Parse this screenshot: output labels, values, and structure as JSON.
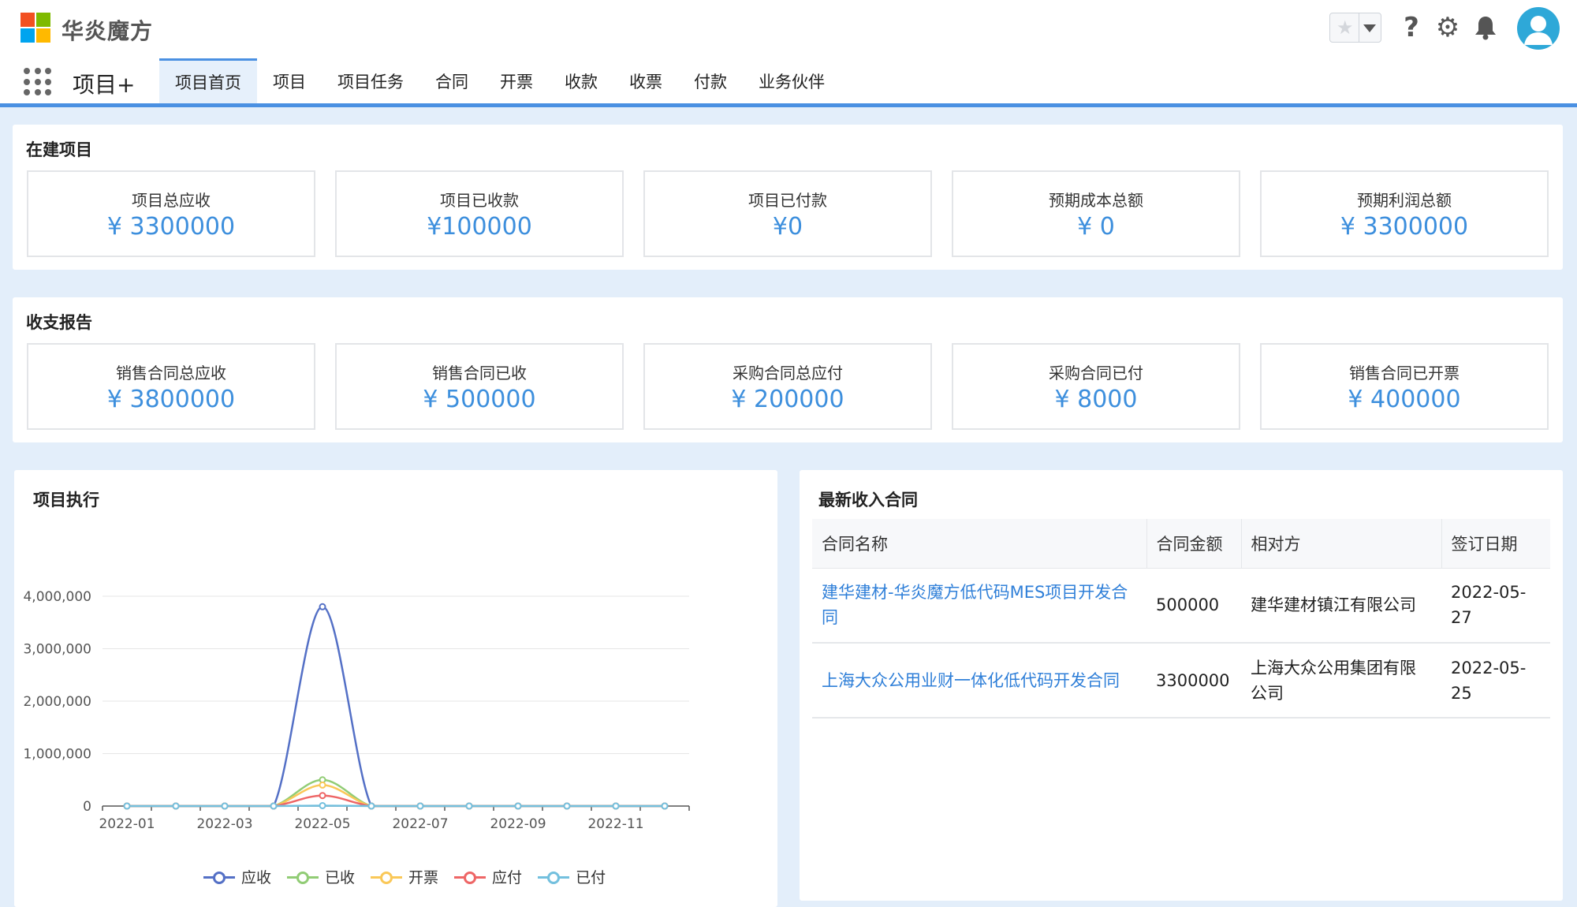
{
  "app": {
    "brand": "华炎魔方",
    "app_name": "项目+",
    "colors": {
      "accent": "#4a90e2",
      "value": "#3d8fdd",
      "link": "#2f7fd8"
    }
  },
  "header_icons": [
    "star-icon",
    "help-icon",
    "gear-icon",
    "bell-icon",
    "avatar-icon"
  ],
  "nav": {
    "tabs": [
      {
        "label": "项目首页",
        "active": true
      },
      {
        "label": "项目"
      },
      {
        "label": "项目任务"
      },
      {
        "label": "合同"
      },
      {
        "label": "开票"
      },
      {
        "label": "收款"
      },
      {
        "label": "收票"
      },
      {
        "label": "付款"
      },
      {
        "label": "业务伙伴"
      }
    ]
  },
  "ongoing": {
    "title": "在建项目",
    "stats": [
      {
        "label": "项目总应收",
        "value": "¥ 3300000"
      },
      {
        "label": "项目已收款",
        "value": "¥100000"
      },
      {
        "label": "项目已付款",
        "value": "¥0"
      },
      {
        "label": "预期成本总额",
        "value": "¥ 0"
      },
      {
        "label": "预期利润总额",
        "value": "¥ 3300000"
      }
    ]
  },
  "report": {
    "title": "收支报告",
    "stats": [
      {
        "label": "销售合同总应收",
        "value": "¥ 3800000"
      },
      {
        "label": "销售合同已收",
        "value": "¥ 500000"
      },
      {
        "label": "采购合同总应付",
        "value": "¥ 200000"
      },
      {
        "label": "采购合同已付",
        "value": "¥ 8000"
      },
      {
        "label": "销售合同已开票",
        "value": "¥ 400000"
      }
    ]
  },
  "execution": {
    "title": "项目执行"
  },
  "chart_data": {
    "type": "line",
    "title": "项目执行",
    "x": [
      "2022-01",
      "2022-02",
      "2022-03",
      "2022-04",
      "2022-05",
      "2022-06",
      "2022-07",
      "2022-08",
      "2022-09",
      "2022-10",
      "2022-11",
      "2022-12"
    ],
    "xtick_labels": [
      "2022-01",
      "2022-03",
      "2022-05",
      "2022-07",
      "2022-09",
      "2022-11"
    ],
    "ytick_labels": [
      "0",
      "1,000,000",
      "2,000,000",
      "3,000,000",
      "4,000,000"
    ],
    "ylim": [
      0,
      4000000
    ],
    "smooth": true,
    "grid": true,
    "legend_position": "bottom",
    "series": [
      {
        "name": "应收",
        "color": "#5470c6",
        "values": [
          0,
          0,
          0,
          0,
          3800000,
          0,
          0,
          0,
          0,
          0,
          0,
          0
        ]
      },
      {
        "name": "已收",
        "color": "#91cc75",
        "values": [
          0,
          0,
          0,
          0,
          500000,
          0,
          0,
          0,
          0,
          0,
          0,
          0
        ]
      },
      {
        "name": "开票",
        "color": "#fac858",
        "values": [
          0,
          0,
          0,
          0,
          400000,
          0,
          0,
          0,
          0,
          0,
          0,
          0
        ]
      },
      {
        "name": "应付",
        "color": "#ee6666",
        "values": [
          0,
          0,
          0,
          0,
          200000,
          0,
          0,
          0,
          0,
          0,
          0,
          0
        ]
      },
      {
        "name": "已付",
        "color": "#73c0de",
        "values": [
          0,
          0,
          0,
          0,
          8000,
          0,
          0,
          0,
          0,
          0,
          0,
          0
        ]
      }
    ]
  },
  "contracts": {
    "title": "最新收入合同",
    "columns": [
      "合同名称",
      "合同金额",
      "相对方",
      "签订日期"
    ],
    "rows": [
      {
        "name": "建华建材-华炎魔方低代码MES项目开发合同",
        "amount": "500000",
        "party": "建华建材镇江有限公司",
        "date": "2022-05-27"
      },
      {
        "name": "上海大众公用业财一体化低代码开发合同",
        "amount": "3300000",
        "party": "上海大众公用集团有限公司",
        "date": "2022-05-25"
      }
    ]
  }
}
